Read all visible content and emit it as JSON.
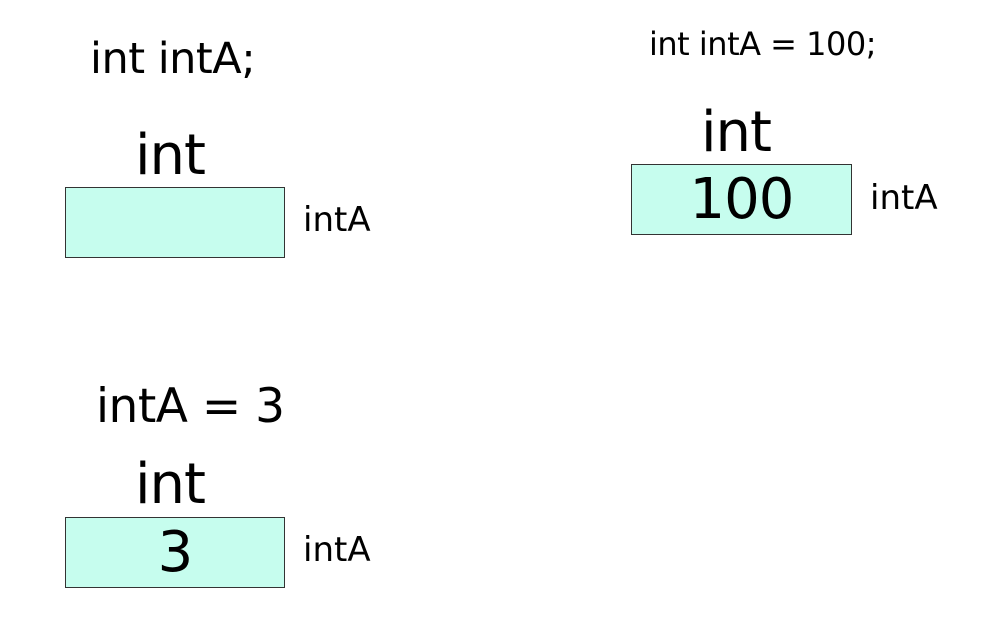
{
  "colors": {
    "box_fill": "#c6fdee",
    "box_border": "#333333",
    "text": "#000000",
    "background": "#ffffff"
  },
  "panels": {
    "declare": {
      "statement": "int intA;",
      "type_label": "int",
      "value": "",
      "var_name": "intA"
    },
    "assign": {
      "statement": "intA = 3",
      "type_label": "int",
      "value": "3",
      "var_name": "intA"
    },
    "initialize": {
      "statement": "int intA = 100;",
      "type_label": "int",
      "value": "100",
      "var_name": "intA"
    }
  }
}
